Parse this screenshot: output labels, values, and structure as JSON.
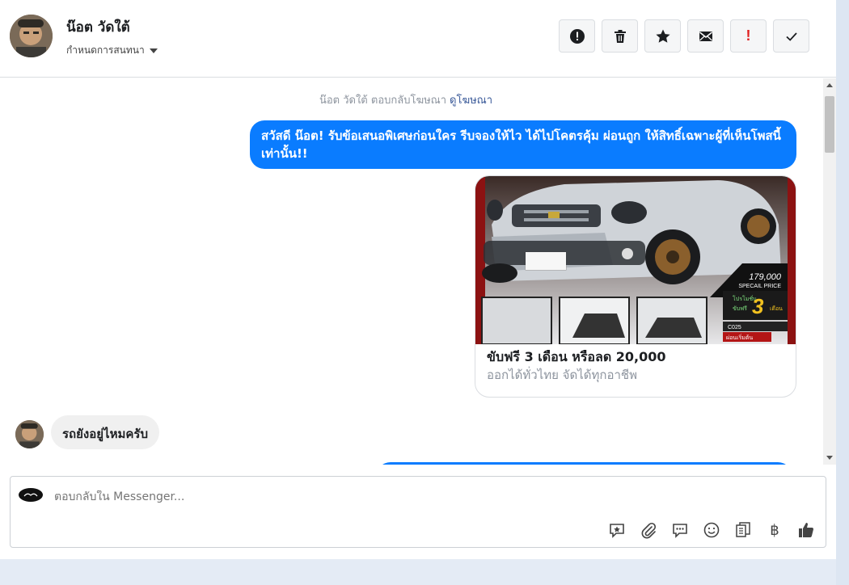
{
  "header": {
    "name": "น๊อต วัดใต้",
    "assign_label": "กำหนดการสนทนา",
    "actions": [
      {
        "icon": "alert-circle-icon"
      },
      {
        "icon": "trash-icon"
      },
      {
        "icon": "star-icon"
      },
      {
        "icon": "envelope-icon"
      },
      {
        "icon": "exclamation-icon",
        "glyph": "!"
      },
      {
        "icon": "checkmark-icon"
      }
    ]
  },
  "thread": {
    "ad_note": "น๊อต วัดใต้ ตอบกลับโฆษณา",
    "ad_link": "ดูโฆษณา",
    "outgoing_message": "สวัสดี น๊อต! รับข้อเสนอพิเศษก่อนใคร รีบจองให้ไว ได้ไปโคตรคุ้ม ผ่อนถูก ให้สิทธิ์เฉพาะผู้ที่เห็นโพสนี้เท่านั้น!!",
    "card": {
      "title": "ขับฟรี 3 เดือน หรือลด 20,000",
      "subtitle": "ออกได้ทั่วไทย จัดได้ทุกอาชีพ",
      "image_price": "179,000",
      "image_special": "SPECAIL PRICE",
      "image_promo": "โปรโมชั่น",
      "image_free": "ขับฟรี",
      "image_number": "3",
      "image_month": "เดือน",
      "image_code": "C025",
      "image_install": "ผ่อนเริ่มต้น"
    },
    "incoming_message": "รถยังอยู่ไหมครับ"
  },
  "composer": {
    "placeholder": "ตอบกลับใน Messenger...",
    "tools": [
      "saved-reply-icon",
      "attachment-icon",
      "chat-bubble-icon",
      "emoji-icon",
      "catalog-icon",
      "baht-icon",
      "thumbs-up-icon"
    ],
    "baht_glyph": "฿"
  },
  "colors": {
    "accent": "#0a7cff",
    "bubble_in": "#f0f0f0",
    "alert_red": "#e02020"
  }
}
